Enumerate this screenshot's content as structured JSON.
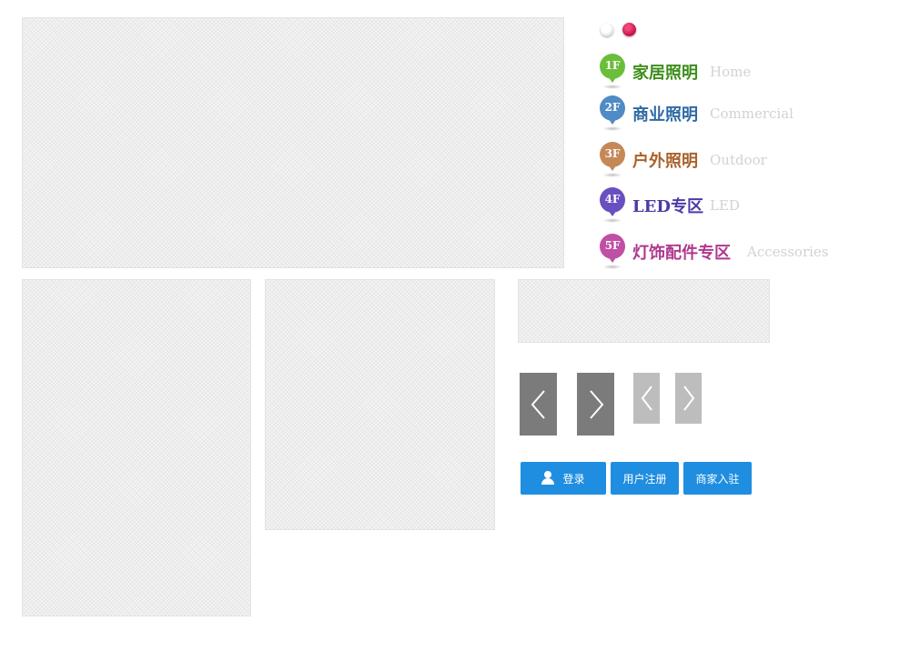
{
  "carousel": {
    "indicator_colors": [
      "#ffffff",
      "#d0154d"
    ],
    "active_index": 1
  },
  "floors": [
    {
      "badge": "1F",
      "name_cn": "家居照明",
      "name_en": "Home",
      "color": "#6bbe3a"
    },
    {
      "badge": "2F",
      "name_cn": "商业照明",
      "name_en": "Commercial",
      "color": "#4f8bc4"
    },
    {
      "badge": "3F",
      "name_cn": "户外照明",
      "name_en": "Outdoor",
      "color": "#c48957"
    },
    {
      "badge": "4F",
      "name_cn": "LED专区",
      "name_en": "LED",
      "color": "#6a4fc0"
    },
    {
      "badge": "5F",
      "name_cn": "灯饰配件专区",
      "name_en": "Accessories",
      "color": "#c04fa6"
    }
  ],
  "arrows": {
    "large_icon_prev": "chevron-left-icon",
    "large_icon_next": "chevron-right-icon",
    "large_color": "#7b7b7b",
    "small_color": "#bdbdbd"
  },
  "buttons": {
    "login": "登录",
    "register": "用户注册",
    "merchant": "商家入驻",
    "color": "#1f8ee0",
    "login_icon": "user-icon"
  }
}
